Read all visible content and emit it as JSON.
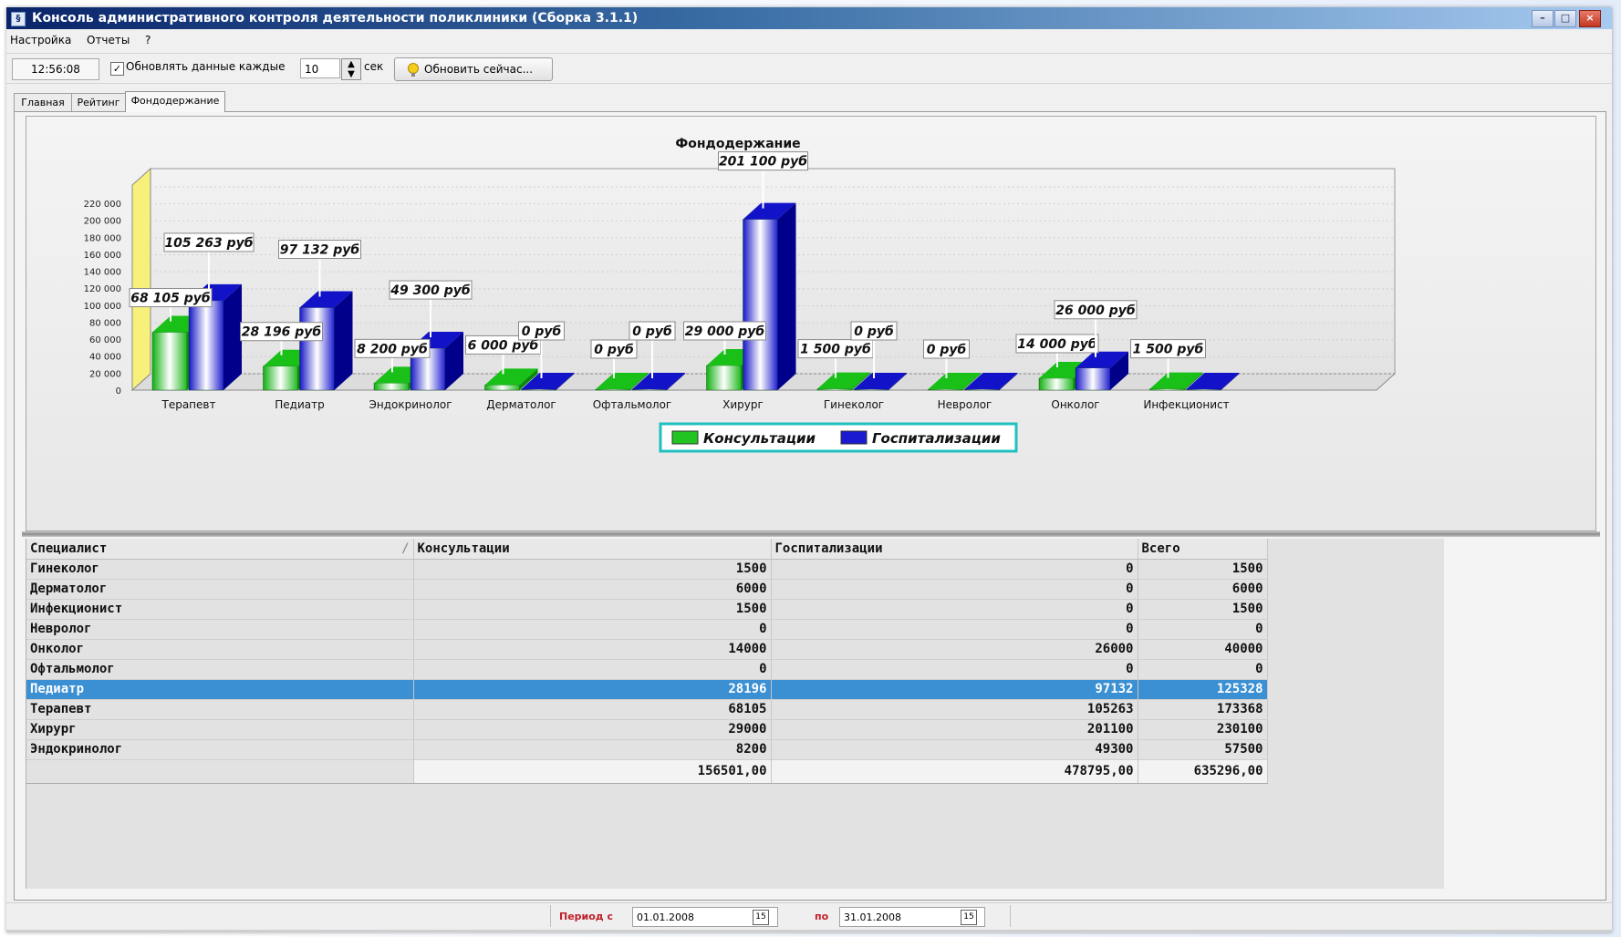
{
  "window": {
    "title": "Консоль административного контроля деятельности поликлиники (Сборка 3.1.1)",
    "controls": {
      "minimize": "–",
      "maximize": "□",
      "close": "×"
    }
  },
  "menu": [
    "Настройка",
    "Отчеты",
    "?"
  ],
  "toolbar": {
    "clock": "12:56:08",
    "auto_refresh_checked": "✓",
    "auto_refresh_label": "Обновлять данные каждые",
    "interval_value": "10",
    "interval_unit": "сек",
    "refresh_now_label": "Обновить сейчас..."
  },
  "tabs": [
    {
      "label": "Главная"
    },
    {
      "label": "Рейтинг"
    },
    {
      "label": "Фондодержание",
      "active": true
    }
  ],
  "chart_data": {
    "type": "bar",
    "title": "Фондодержание",
    "categories": [
      "Терапевт",
      "Педиатр",
      "Эндокринолог",
      "Дерматолог",
      "Офтальмолог",
      "Хирург",
      "Гинеколог",
      "Невролог",
      "Онколог",
      "Инфекционист"
    ],
    "series": [
      {
        "name": "Консультации",
        "color": "#22c422",
        "values": [
          68105,
          28196,
          8200,
          6000,
          0,
          29000,
          1500,
          0,
          14000,
          1500
        ]
      },
      {
        "name": "Госпитализации",
        "color": "#1a1ad0",
        "values": [
          105263,
          97132,
          49300,
          0,
          0,
          201100,
          0,
          0,
          26000,
          0
        ]
      }
    ],
    "labels": [
      [
        "68 105 руб",
        "105 263 руб"
      ],
      [
        "28 196 руб",
        "97 132 руб"
      ],
      [
        "8 200 руб",
        "49 300 руб"
      ],
      [
        "6 000 руб",
        "0 руб"
      ],
      [
        "0 руб",
        "0 руб"
      ],
      [
        "29 000 руб",
        "201 100 руб"
      ],
      [
        "1 500 руб",
        "0 руб"
      ],
      [
        "0 руб",
        ""
      ],
      [
        "14 000 руб",
        "26 000 руб"
      ],
      [
        "1 500 руб",
        ""
      ]
    ],
    "y_ticks": [
      "0",
      "20 000",
      "40 000",
      "60 000",
      "80 000",
      "100 000",
      "120 000",
      "140 000",
      "160 000",
      "180 000",
      "200 000",
      "220 000"
    ],
    "ylim": [
      0,
      220000
    ],
    "legend": {
      "position": "bottom-center"
    },
    "grid": true
  },
  "table": {
    "columns": [
      "Специалист",
      "Консультации",
      "Госпитализации",
      "Всего"
    ],
    "rows": [
      [
        "Гинеколог",
        "1500",
        "0",
        "1500"
      ],
      [
        "Дерматолог",
        "6000",
        "0",
        "6000"
      ],
      [
        "Инфекционист",
        "1500",
        "0",
        "1500"
      ],
      [
        "Невролог",
        "0",
        "0",
        "0"
      ],
      [
        "Онколог",
        "14000",
        "26000",
        "40000"
      ],
      [
        "Офтальмолог",
        "0",
        "0",
        "0"
      ],
      [
        "Педиатр",
        "28196",
        "97132",
        "125328"
      ],
      [
        "Терапевт",
        "68105",
        "105263",
        "173368"
      ],
      [
        "Хирург",
        "29000",
        "201100",
        "230100"
      ],
      [
        "Эндокринолог",
        "8200",
        "49300",
        "57500"
      ]
    ],
    "selected_row": "Педиатр",
    "totals": [
      "",
      "156501,00",
      "478795,00",
      "635296,00"
    ]
  },
  "status": {
    "period_from_label": "Период с",
    "date_from": "01.01.2008",
    "period_to_label": "по",
    "date_to": "31.01.2008"
  }
}
